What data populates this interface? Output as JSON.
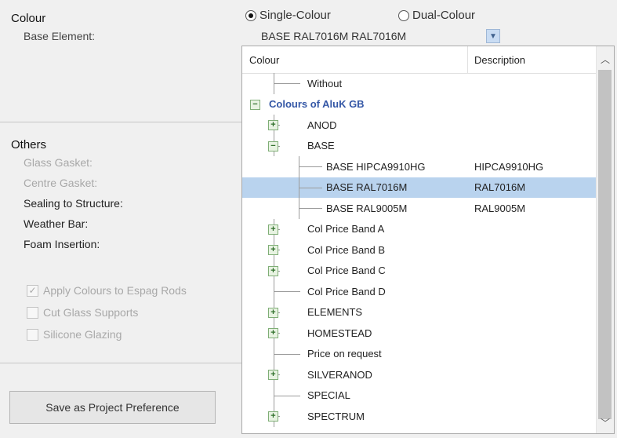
{
  "colour_section": {
    "title": "Colour",
    "base_element_label": "Base Element:"
  },
  "colour_mode": {
    "single_label": "Single-Colour",
    "dual_label": "Dual-Colour",
    "selected": "single"
  },
  "base_element_combo": {
    "value": "BASE RAL7016M RAL7016M",
    "arrow_icon": "chevron-down-icon"
  },
  "others_section": {
    "title": "Others",
    "fields": [
      {
        "label": "Glass Gasket:",
        "disabled": true
      },
      {
        "label": "Centre Gasket:",
        "disabled": true
      },
      {
        "label": "Sealing to Structure:",
        "disabled": false
      },
      {
        "label": "Weather Bar:",
        "disabled": false
      },
      {
        "label": "Foam Insertion:",
        "disabled": false
      }
    ]
  },
  "options": [
    {
      "label": "Apply Colours to Espag Rods",
      "checked": true,
      "disabled": true
    },
    {
      "label": "Cut Glass Supports",
      "checked": false,
      "disabled": true
    },
    {
      "label": "Silicone Glazing",
      "checked": false,
      "disabled": true
    }
  ],
  "save_button": {
    "label": "Save as Project Preference"
  },
  "colour_grid": {
    "headers": {
      "colour": "Colour",
      "description": "Description"
    },
    "rows": [
      {
        "label": "Without",
        "desc": "",
        "level": 1,
        "expander": null,
        "selected": false,
        "bold": false
      },
      {
        "label": "Colours of AluK GB",
        "desc": "",
        "level": 0,
        "expander": "minus",
        "selected": false,
        "bold": true
      },
      {
        "label": "ANOD",
        "desc": "",
        "level": 1,
        "expander": "plus",
        "selected": false,
        "bold": false
      },
      {
        "label": "BASE",
        "desc": "",
        "level": 1,
        "expander": "minus",
        "selected": false,
        "bold": false
      },
      {
        "label": "BASE HIPCA9910HG",
        "desc": "HIPCA9910HG",
        "level": 2,
        "expander": null,
        "selected": false,
        "bold": false
      },
      {
        "label": "BASE RAL7016M",
        "desc": "RAL7016M",
        "level": 2,
        "expander": null,
        "selected": true,
        "bold": false
      },
      {
        "label": "BASE RAL9005M",
        "desc": "RAL9005M",
        "level": 2,
        "expander": null,
        "selected": false,
        "bold": false
      },
      {
        "label": "Col Price Band A",
        "desc": "",
        "level": 1,
        "expander": "plus",
        "selected": false,
        "bold": false
      },
      {
        "label": "Col Price Band B",
        "desc": "",
        "level": 1,
        "expander": "plus",
        "selected": false,
        "bold": false
      },
      {
        "label": "Col Price Band C",
        "desc": "",
        "level": 1,
        "expander": "plus",
        "selected": false,
        "bold": false
      },
      {
        "label": "Col Price Band D",
        "desc": "",
        "level": 1,
        "expander": null,
        "selected": false,
        "bold": false
      },
      {
        "label": "ELEMENTS",
        "desc": "",
        "level": 1,
        "expander": "plus",
        "selected": false,
        "bold": false
      },
      {
        "label": "HOMESTEAD",
        "desc": "",
        "level": 1,
        "expander": "plus",
        "selected": false,
        "bold": false
      },
      {
        "label": "Price on request",
        "desc": "",
        "level": 1,
        "expander": null,
        "selected": false,
        "bold": false
      },
      {
        "label": "SILVERANOD",
        "desc": "",
        "level": 1,
        "expander": "plus",
        "selected": false,
        "bold": false
      },
      {
        "label": "SPECIAL",
        "desc": "",
        "level": 1,
        "expander": null,
        "selected": false,
        "bold": false
      },
      {
        "label": "SPECTRUM",
        "desc": "",
        "level": 1,
        "expander": "plus",
        "selected": false,
        "bold": false
      }
    ]
  },
  "scrollbar": {
    "up_icon": "chevron-up-icon",
    "down_icon": "chevron-down-icon"
  },
  "colors": {
    "selection": "#b9d3ee",
    "group_text": "#3457a6",
    "expander_border": "#7fae76"
  }
}
